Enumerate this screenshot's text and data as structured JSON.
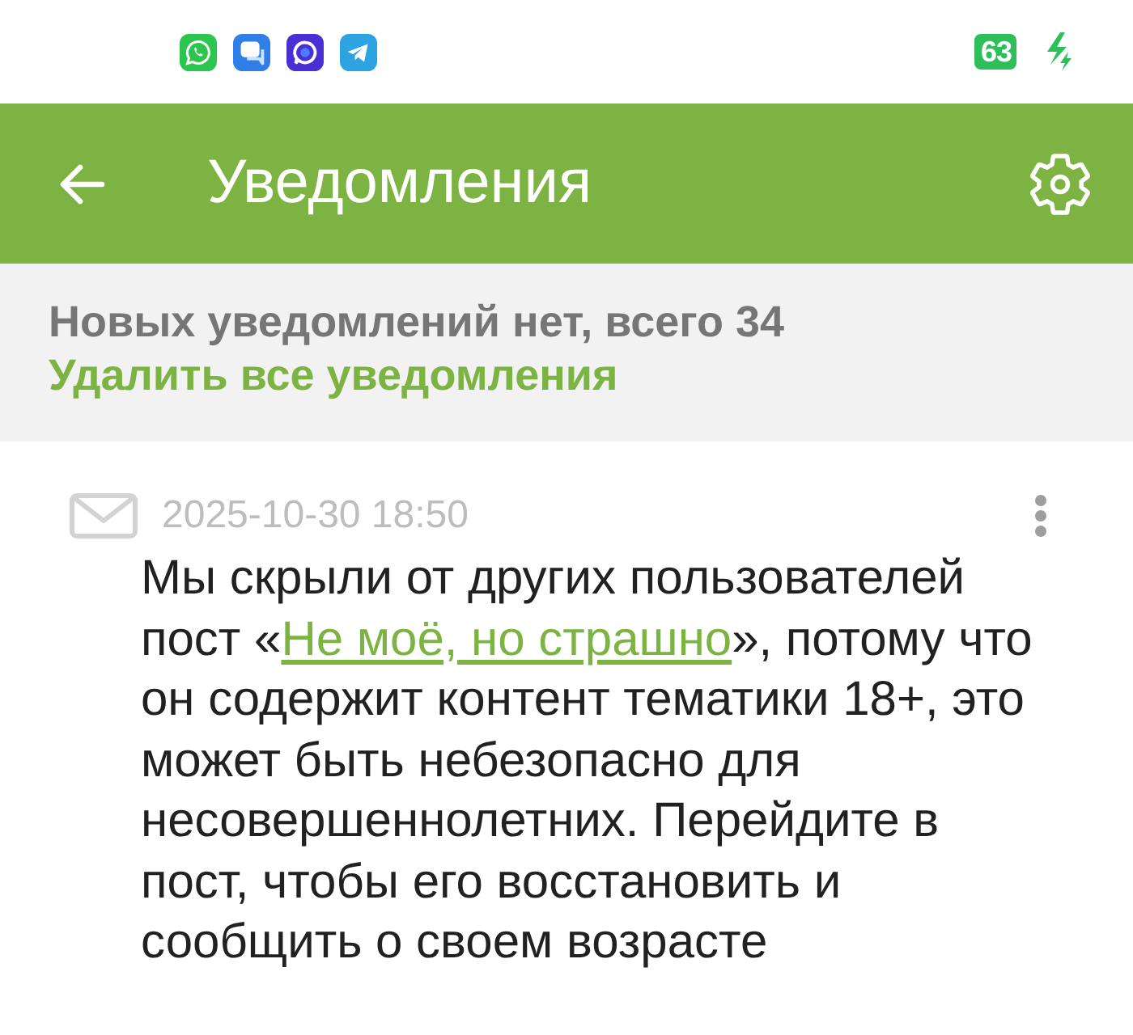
{
  "status_bar": {
    "battery": "63"
  },
  "app_bar": {
    "title": "Уведомления"
  },
  "summary": {
    "text": "Новых уведомлений нет, всего 34",
    "action": "Удалить все уведомления"
  },
  "notifications": [
    {
      "date": "2025-10-30 18:50",
      "text_before": "Мы скрыли от других пользователей пост «",
      "link": "Не моё, но страшно",
      "text_after": "», потому что он содержит контент тематики 18+, это может быть небезопасно для несовершеннолетних. Перейдите в пост, чтобы его восстановить и сообщить о своем возрасте"
    }
  ]
}
